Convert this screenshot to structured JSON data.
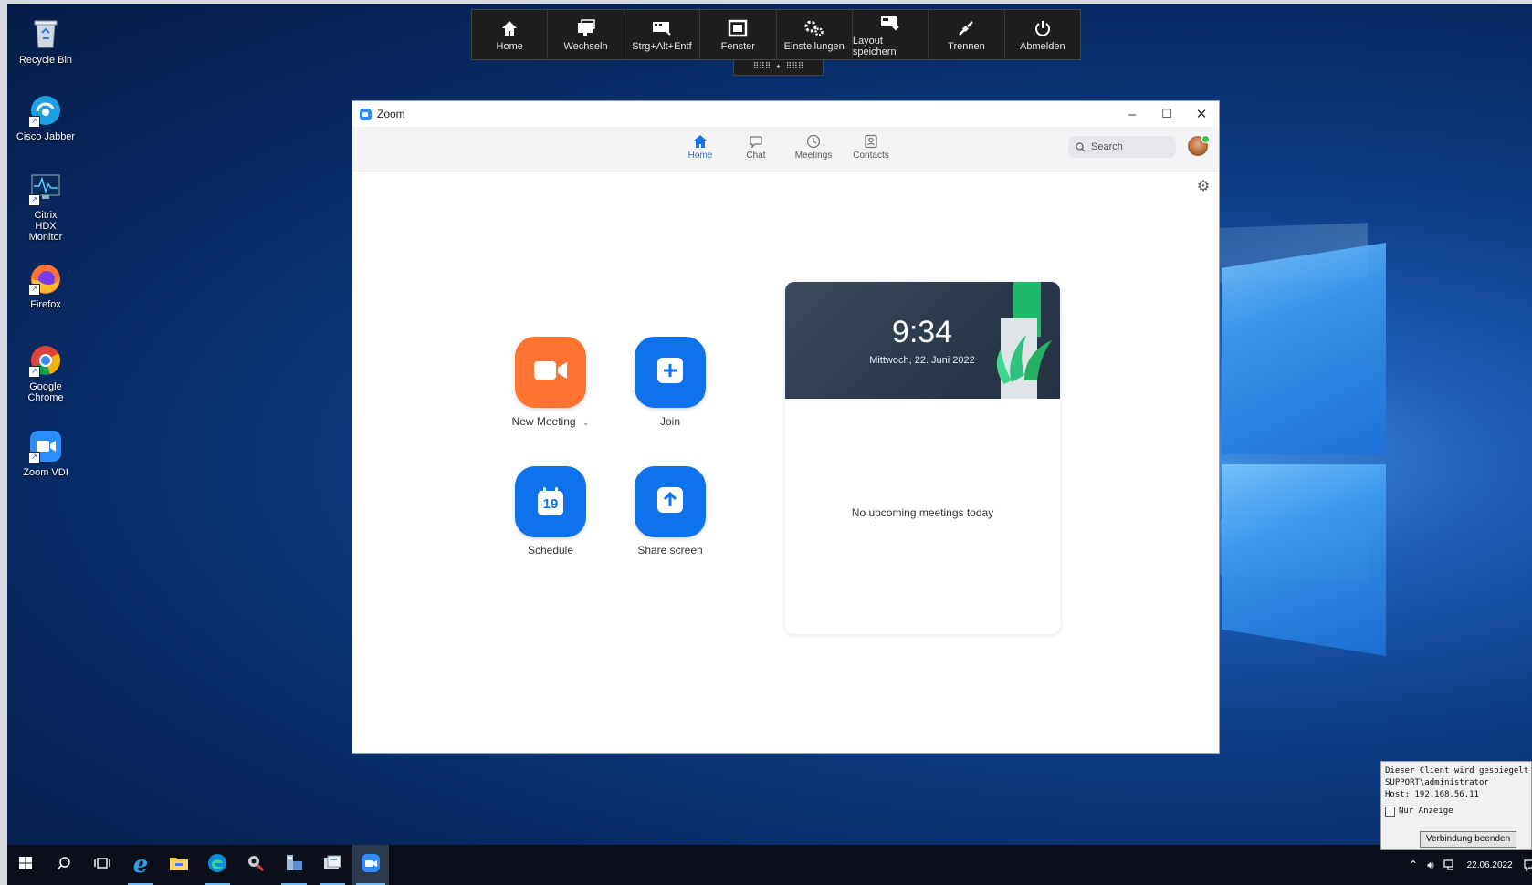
{
  "desktop": {
    "icons": [
      {
        "label": "Recycle Bin",
        "icon": "recycle-bin-icon"
      },
      {
        "label": "Cisco Jabber",
        "icon": "cisco-jabber-icon"
      },
      {
        "label": "Citrix HDX Monitor",
        "icon": "citrix-hdx-monitor-icon"
      },
      {
        "label": "Firefox",
        "icon": "firefox-icon"
      },
      {
        "label": "Google Chrome",
        "icon": "chrome-icon"
      },
      {
        "label": "Zoom VDI",
        "icon": "zoom-vdi-icon"
      }
    ]
  },
  "citrix_toolbar": {
    "buttons": [
      {
        "label": "Home",
        "icon": "home-icon"
      },
      {
        "label": "Wechseln",
        "icon": "switch-icon"
      },
      {
        "label": "Strg+Alt+Entf",
        "icon": "ctrl-alt-del-icon"
      },
      {
        "label": "Fenster",
        "icon": "window-icon"
      },
      {
        "label": "Einstellungen",
        "icon": "settings-icon"
      },
      {
        "label": "Layout speichern",
        "icon": "save-layout-icon"
      },
      {
        "label": "Trennen",
        "icon": "disconnect-icon"
      },
      {
        "label": "Abmelden",
        "icon": "power-icon"
      }
    ],
    "handle": "⠿⠿⠿ ✦ ⠿⠿⠿"
  },
  "zoom": {
    "title": "Zoom",
    "window_controls": {
      "minimize": "–",
      "maximize": "☐",
      "close": "✕"
    },
    "nav": {
      "tabs": [
        {
          "label": "Home",
          "icon": "home-icon",
          "active": true
        },
        {
          "label": "Chat",
          "icon": "chat-icon",
          "active": false
        },
        {
          "label": "Meetings",
          "icon": "clock-icon",
          "active": false
        },
        {
          "label": "Contacts",
          "icon": "contacts-icon",
          "active": false
        }
      ],
      "search_placeholder": "Search"
    },
    "actions": {
      "new_meeting": "New Meeting",
      "join": "Join",
      "schedule": "Schedule",
      "schedule_day": "19",
      "share_screen": "Share screen"
    },
    "card": {
      "time": "9:34",
      "date": "Mittwoch, 22. Juni 2022",
      "empty": "No upcoming meetings today"
    },
    "colors": {
      "orange": "#ff742e",
      "blue": "#0e72ed",
      "accent": "#1a73e8"
    }
  },
  "taskbar": {
    "items": [
      {
        "name": "start-button",
        "icon": "windows-start-icon"
      },
      {
        "name": "search-button",
        "icon": "search-icon"
      },
      {
        "name": "task-view-button",
        "icon": "task-view-icon"
      },
      {
        "name": "internet-explorer",
        "icon": "ie-icon"
      },
      {
        "name": "file-explorer",
        "icon": "folder-icon"
      },
      {
        "name": "edge",
        "icon": "edge-icon"
      },
      {
        "name": "app-tool",
        "icon": "tool-icon"
      },
      {
        "name": "server-manager",
        "icon": "server-manager-icon"
      },
      {
        "name": "app-misc",
        "icon": "app-icon"
      },
      {
        "name": "zoom-vdi",
        "icon": "zoom-icon"
      }
    ],
    "date": "22.06.2022"
  },
  "shadow_panel": {
    "line1": "Dieser Client wird gespiegelt v",
    "line2": "SUPPORT\\administrator",
    "line3": "Host: 192.168.56.11",
    "checkbox_label": "Nur Anzeige",
    "button": "Verbindung beenden"
  }
}
